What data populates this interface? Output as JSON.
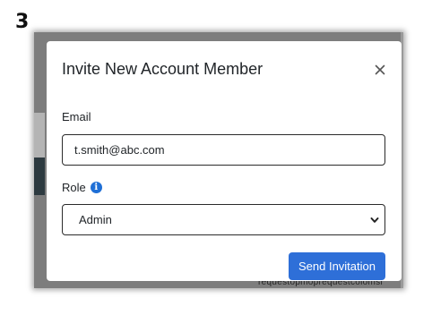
{
  "step": {
    "number": "3"
  },
  "modal": {
    "title": "Invite New Account Member",
    "close_label": "×"
  },
  "email": {
    "label": "Email",
    "value": "t.smith@abc.com"
  },
  "role": {
    "label": "Role",
    "info_icon": "info-icon",
    "selected": "Admin"
  },
  "actions": {
    "send_label": "Send Invitation"
  },
  "backdrop": {
    "partial_text": "requestopmoprequestcolomsi"
  },
  "colors": {
    "primary": "#2e6fd8",
    "info": "#1f6fd6",
    "overlay": "#7d7d7d"
  }
}
